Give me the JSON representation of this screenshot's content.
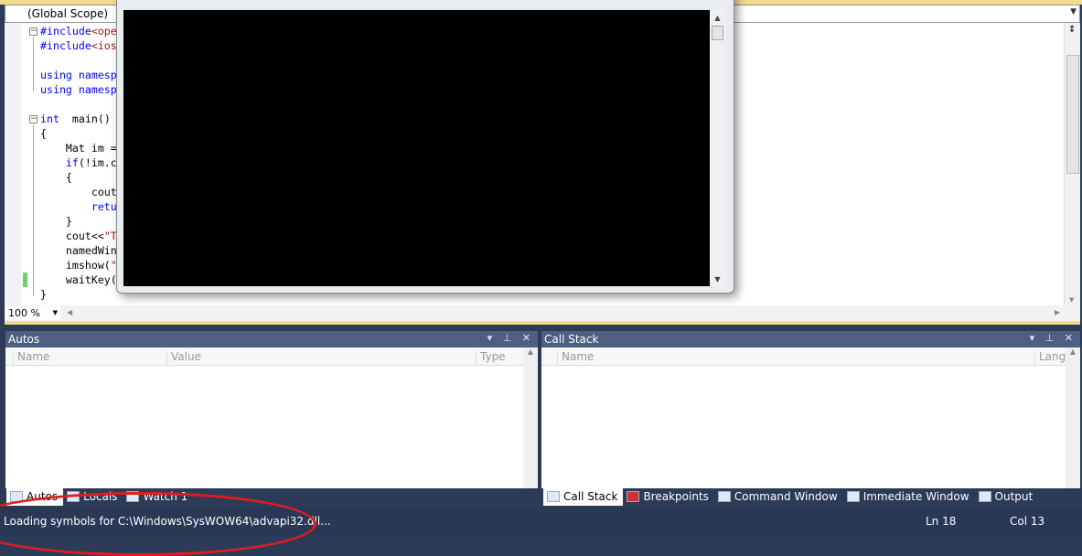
{
  "navigation": {
    "scope": "(Global Scope)"
  },
  "editor": {
    "lines": [
      {
        "parts": [
          [
            "kw",
            "#include"
          ],
          [
            "str",
            "<ope"
          ]
        ]
      },
      {
        "parts": [
          [
            "kw",
            "#include"
          ],
          [
            "str",
            "<ios"
          ]
        ]
      },
      {
        "parts": []
      },
      {
        "parts": [
          [
            "kw",
            "using namesp"
          ]
        ]
      },
      {
        "parts": [
          [
            "kw",
            "using namesp"
          ]
        ]
      },
      {
        "parts": []
      },
      {
        "parts": [
          [
            "kw",
            "int"
          ],
          [
            "",
            "  main()"
          ]
        ]
      },
      {
        "parts": [
          [
            "",
            "{"
          ]
        ]
      },
      {
        "parts": [
          [
            "",
            "    Mat im ="
          ]
        ]
      },
      {
        "parts": [
          [
            "",
            "    "
          ],
          [
            "kw",
            "if"
          ],
          [
            "",
            "(!im.c"
          ]
        ]
      },
      {
        "parts": [
          [
            "",
            "    {"
          ]
        ]
      },
      {
        "parts": [
          [
            "",
            "        cout"
          ]
        ]
      },
      {
        "parts": [
          [
            "",
            "        "
          ],
          [
            "kw",
            "retu"
          ]
        ]
      },
      {
        "parts": [
          [
            "",
            "    }"
          ]
        ]
      },
      {
        "parts": [
          [
            "",
            "    cout<<"
          ],
          [
            "str",
            "\"T"
          ]
        ]
      },
      {
        "parts": [
          [
            "",
            "    namedWin"
          ]
        ]
      },
      {
        "parts": [
          [
            "",
            "    imshow("
          ],
          [
            "str",
            "\""
          ]
        ]
      },
      {
        "parts": [
          [
            "",
            "    waitKey("
          ]
        ]
      },
      {
        "parts": [
          [
            "",
            "}"
          ]
        ]
      }
    ],
    "zoom": "100 %"
  },
  "autos": {
    "title": "Autos",
    "columns": [
      "Name",
      "Value",
      "Type"
    ]
  },
  "call_stack": {
    "title": "Call Stack",
    "columns": [
      "Name",
      "Lang"
    ]
  },
  "left_tabs": [
    "Autos",
    "Locals",
    "Watch 1"
  ],
  "right_tabs": [
    "Call Stack",
    "Breakpoints",
    "Command Window",
    "Immediate Window",
    "Output"
  ],
  "status": {
    "message": "Loading symbols for C:\\Windows\\SysWOW64\\advapi32.dll...",
    "line": "Ln 18",
    "col": "Col 13"
  },
  "colors": {
    "status_bg": "#293955",
    "panel_header": "#4d6082",
    "annotation": "#e31b1b"
  }
}
